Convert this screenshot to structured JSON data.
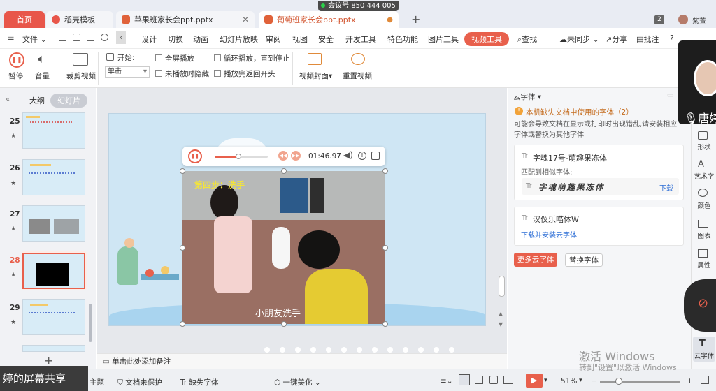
{
  "meeting": {
    "label": "会议号 850 444 005"
  },
  "tabs": [
    {
      "label": "首页"
    },
    {
      "label": "稻壳模板"
    },
    {
      "label": "苹果班家长会ppt.pptx"
    },
    {
      "label": "葡萄班家长会ppt.pptx"
    }
  ],
  "titlebar": {
    "badge": "2",
    "user": "紫萱"
  },
  "menu": {
    "file": "文件",
    "items": [
      "设计",
      "切换",
      "动画",
      "幻灯片放映",
      "审阅",
      "视图",
      "安全",
      "开发工具",
      "特色功能",
      "图片工具"
    ],
    "video_tools": "视频工具",
    "search": "查找",
    "sync": "未同步",
    "share": "分享",
    "comment": "批注"
  },
  "ribbon": {
    "pause": "暂停",
    "volume": "音量",
    "trim": "裁剪视频",
    "start_label": "开始:",
    "start_value": "单击",
    "fullscreen": "全屏播放",
    "hide_not_playing": "未播放时隐藏",
    "loop": "循环播放，直到停止",
    "rewind": "播放完返回开头",
    "cover": "视频封面",
    "reset": "重置视频"
  },
  "left_panel": {
    "outline_tab": "大纲",
    "slides_tab": "幻灯片",
    "slides": [
      {
        "num": "25"
      },
      {
        "num": "26"
      },
      {
        "num": "27"
      },
      {
        "num": "28"
      },
      {
        "num": "29"
      }
    ],
    "star": "★"
  },
  "video": {
    "time": "01:46.97",
    "progress": 0.45,
    "step_text": "第四步：洗手",
    "subtitle": "小朋友洗手"
  },
  "notes_placeholder": "单击此处添加备注",
  "cloud_fonts": {
    "header": "云字体",
    "warning": "本机缺失文档中使用的字体（2）",
    "warning_desc": "可能会导致文档在显示或打印时出现错乱,请安装相应字体或替换为其他字体",
    "font1": {
      "name": "字魂17号-萌趣果冻体",
      "match_label": "匹配到相似字体:",
      "match_name": "字魂萌趣果冻体",
      "download": "下载"
    },
    "font2": {
      "name": "汉仪乐喵体W",
      "action": "下载并安装云字体"
    },
    "more_button": "更多云字体",
    "replace_button": "替换字体"
  },
  "side_tools": [
    "形状",
    "艺术字",
    "颜色",
    "图表",
    "属性",
    "云字体"
  ],
  "camera_overlay": {
    "name": "唐婷"
  },
  "status": {
    "screen_share": "婷的屏幕共享",
    "theme": "主题",
    "protect": "文档未保护",
    "missing_font": "缺失字体",
    "beautify": "一键美化",
    "zoom": "51%"
  },
  "watermark": {
    "line1": "激活 Windows",
    "line2": "转到\"设置\"以激活 Windows"
  }
}
